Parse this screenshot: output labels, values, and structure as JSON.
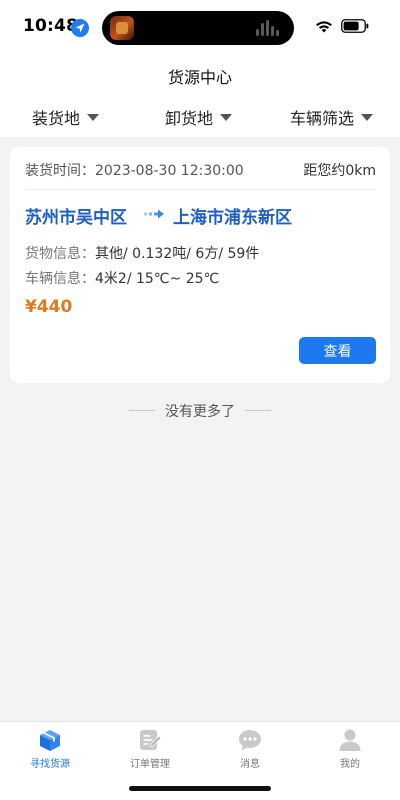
{
  "status_bar": {
    "time": "10:48",
    "icons": [
      "location-arrow-icon",
      "app-icon",
      "audio-wave-icon",
      "wifi-icon",
      "battery-icon"
    ]
  },
  "nav": {
    "title": "货源中心"
  },
  "filters": [
    {
      "label": "装货地",
      "icon": "chevron-down-icon"
    },
    {
      "label": "卸货地",
      "icon": "chevron-down-icon"
    },
    {
      "label": "车辆筛选",
      "icon": "chevron-down-icon"
    }
  ],
  "card": {
    "load_time": "装货时间：2023-08-30 12:30:00",
    "distance": "距您约0km",
    "from": "苏州市吴中区",
    "to": "上海市浦东新区",
    "cargo_label": "货物信息：",
    "cargo_value": "其他/ 0.132吨/ 6方/ 59件",
    "vehicle_label": "车辆信息：",
    "vehicle_value": "4米2/ 15℃~ 25℃",
    "price": "¥440",
    "view_button": "查看"
  },
  "no_more": "没有更多了",
  "tabs": [
    {
      "label": "寻找货源",
      "icon": "cube-icon",
      "active": true
    },
    {
      "label": "订单管理",
      "icon": "edit-document-icon",
      "active": false
    },
    {
      "label": "消息",
      "icon": "chat-bubble-icon",
      "active": false
    },
    {
      "label": "我的",
      "icon": "person-icon",
      "active": false
    }
  ],
  "colors": {
    "accent": "#1e78f0",
    "route_text": "#1d5fc4",
    "price": "#e07a1c",
    "background": "#f2f3f5"
  }
}
